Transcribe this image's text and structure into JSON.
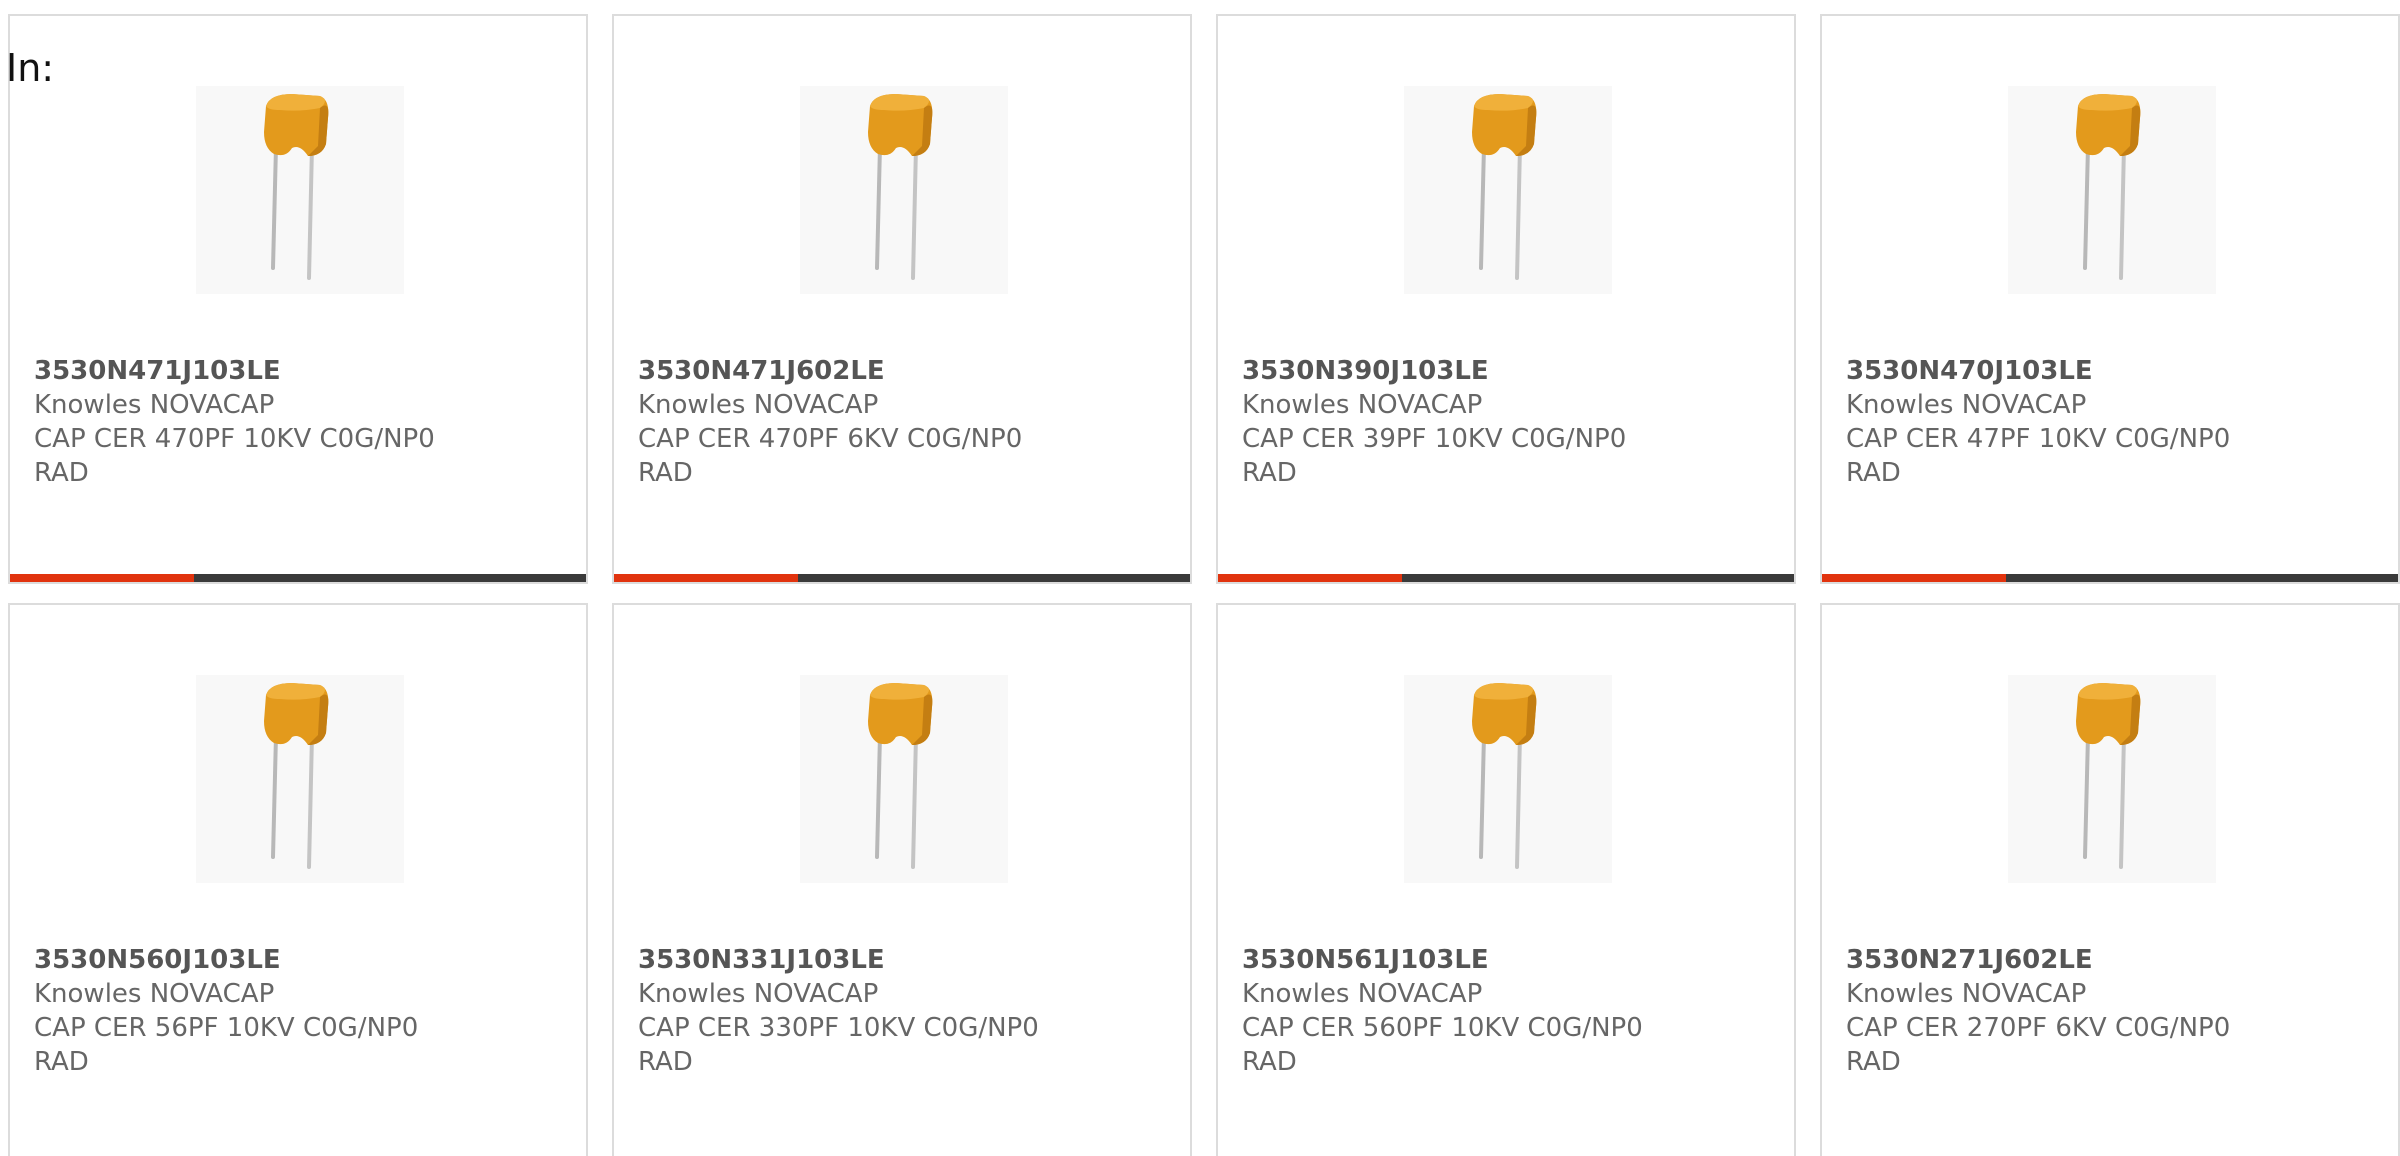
{
  "header": {
    "in_label": "In:"
  },
  "colors": {
    "accent": "#e1330e",
    "bar_track": "#3a3a3a",
    "capacitor_body": "#e39a1c"
  },
  "products": [
    {
      "part_number": "3530N471J103LE",
      "manufacturer": "Knowles NOVACAP",
      "description": "CAP CER 470PF 10KV C0G/NP0",
      "package": "RAD",
      "image_icon": "radial-capacitor-image",
      "progress_fraction": 0.32
    },
    {
      "part_number": "3530N471J602LE",
      "manufacturer": "Knowles NOVACAP",
      "description": "CAP CER 470PF 6KV C0G/NP0",
      "package": "RAD",
      "image_icon": "radial-capacitor-image",
      "progress_fraction": 0.32
    },
    {
      "part_number": "3530N390J103LE",
      "manufacturer": "Knowles NOVACAP",
      "description": "CAP CER 39PF 10KV C0G/NP0",
      "package": "RAD",
      "image_icon": "radial-capacitor-image",
      "progress_fraction": 0.32
    },
    {
      "part_number": "3530N470J103LE",
      "manufacturer": "Knowles NOVACAP",
      "description": "CAP CER 47PF 10KV C0G/NP0",
      "package": "RAD",
      "image_icon": "radial-capacitor-image",
      "progress_fraction": 0.32
    },
    {
      "part_number": "3530N560J103LE",
      "manufacturer": "Knowles NOVACAP",
      "description": "CAP CER 56PF 10KV C0G/NP0",
      "package": "RAD",
      "image_icon": "radial-capacitor-image"
    },
    {
      "part_number": "3530N331J103LE",
      "manufacturer": "Knowles NOVACAP",
      "description": "CAP CER 330PF 10KV C0G/NP0",
      "package": "RAD",
      "image_icon": "radial-capacitor-image"
    },
    {
      "part_number": "3530N561J103LE",
      "manufacturer": "Knowles NOVACAP",
      "description": "CAP CER 560PF 10KV C0G/NP0",
      "package": "RAD",
      "image_icon": "radial-capacitor-image"
    },
    {
      "part_number": "3530N271J602LE",
      "manufacturer": "Knowles NOVACAP",
      "description": "CAP CER 270PF 6KV C0G/NP0",
      "package": "RAD",
      "image_icon": "radial-capacitor-image"
    }
  ]
}
